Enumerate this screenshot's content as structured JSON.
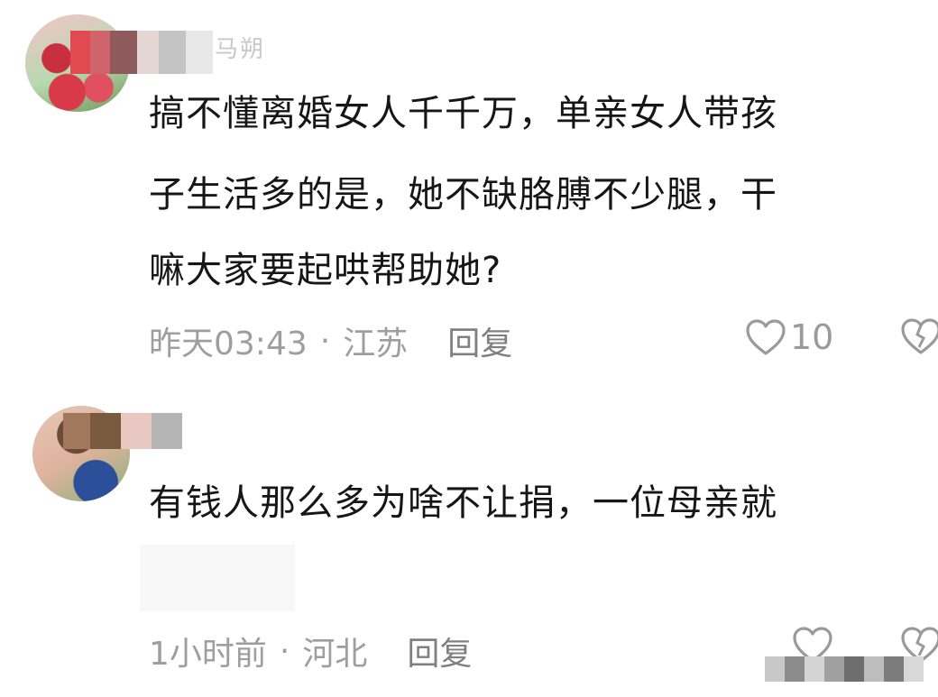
{
  "comments": [
    {
      "username_visible": "马朔",
      "lines": [
        "搞不懂离婚女人千千万，单亲女人带孩",
        "子生活多的是，她不缺胳膊不少腿，干",
        "嘛大家要起哄帮助她?"
      ],
      "time": "昨天03:43",
      "separator": "·",
      "location": "江苏",
      "reply_label": "回复",
      "like_count": "10"
    },
    {
      "username_visible": "",
      "lines": [
        "有钱人那么多为啥不让捐，一位母亲就"
      ],
      "time": "1小时前",
      "separator": "·",
      "location": "河北",
      "reply_label": "回复",
      "like_count": ""
    }
  ],
  "colors": {
    "text": "#161616",
    "meta": "#9e9e9e",
    "icon": "#9a9a9a",
    "background": "#ffffff"
  },
  "icons": {
    "like": "heart-outline-icon",
    "dislike": "broken-heart-icon"
  }
}
